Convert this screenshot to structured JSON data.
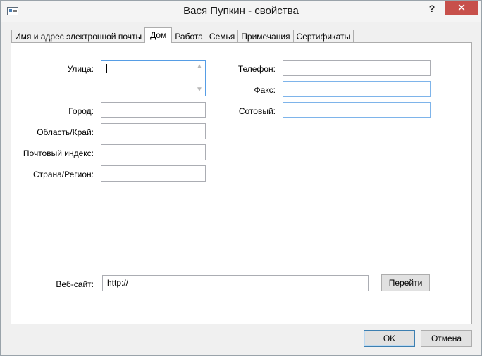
{
  "window": {
    "title": "Вася Пупкин - свойства",
    "help": "?",
    "close": "✕"
  },
  "tabs": [
    {
      "label": "Имя и адрес электронной почты"
    },
    {
      "label": "Дом"
    },
    {
      "label": "Работа"
    },
    {
      "label": "Семья"
    },
    {
      "label": "Примечания"
    },
    {
      "label": "Сертификаты"
    }
  ],
  "active_tab": "Дом",
  "form": {
    "street": {
      "label": "Улица:",
      "value": ""
    },
    "city": {
      "label": "Город:",
      "value": ""
    },
    "region": {
      "label": "Область/Край:",
      "value": ""
    },
    "zip": {
      "label": "Почтовый индекс:",
      "value": ""
    },
    "country": {
      "label": "Страна/Регион:",
      "value": ""
    },
    "phone": {
      "label": "Телефон:",
      "value": ""
    },
    "fax": {
      "label": "Факс:",
      "value": ""
    },
    "mobile": {
      "label": "Сотовый:",
      "value": ""
    },
    "website": {
      "label": "Веб-сайт:",
      "value": "http://"
    },
    "go_button": "Перейти"
  },
  "footer": {
    "ok": "OK",
    "cancel": "Отмена"
  },
  "icons": {
    "window_icon": "contact-card-icon",
    "scroll_up": "chevron-up-icon",
    "scroll_down": "chevron-down-icon"
  }
}
